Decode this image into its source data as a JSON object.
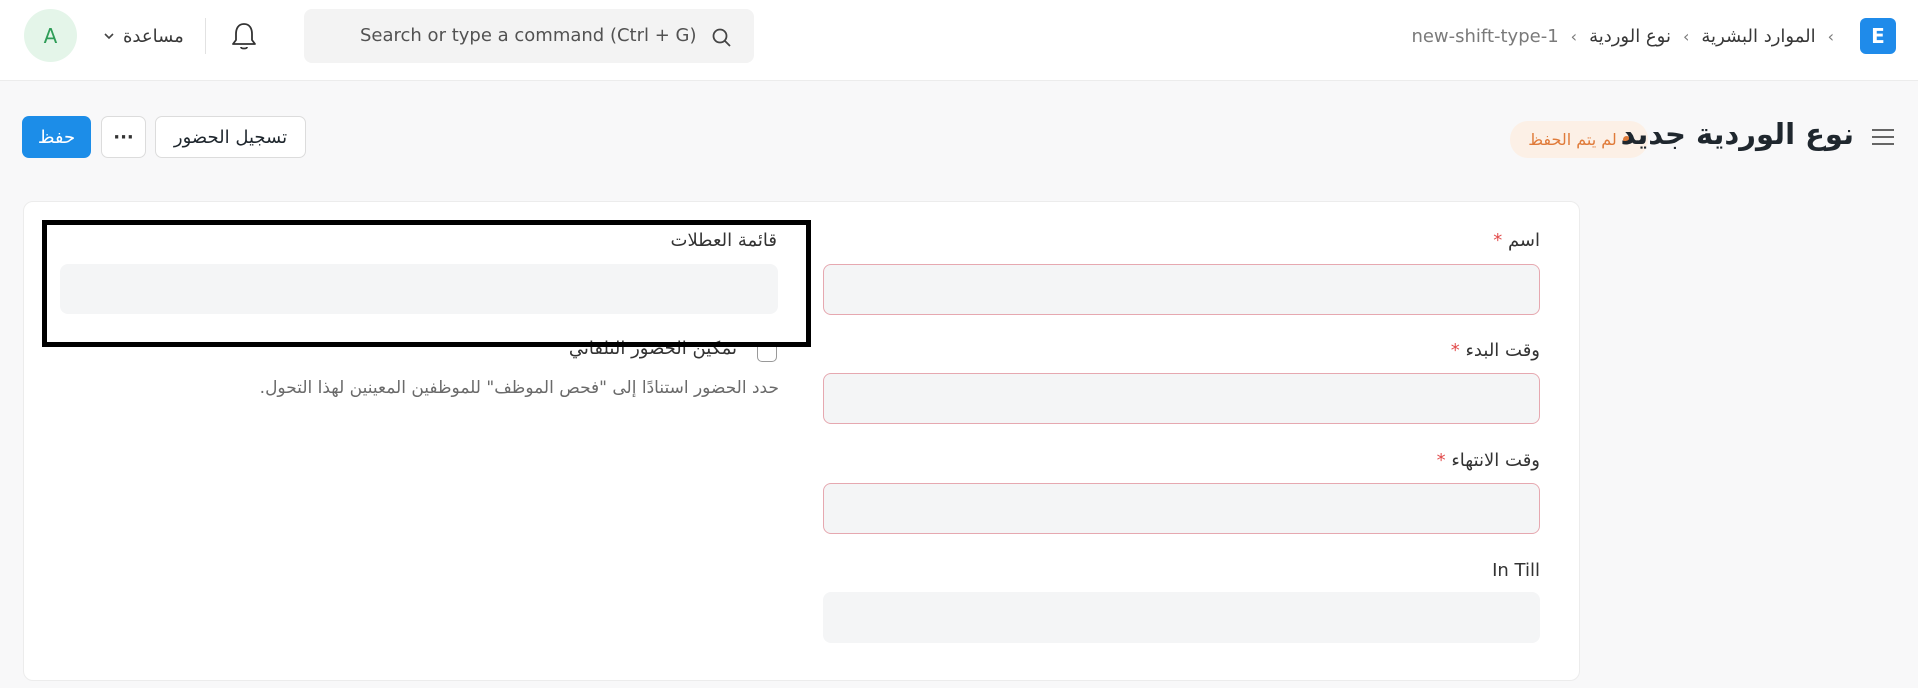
{
  "navbar": {
    "avatar_initial": "A",
    "help_label": "مساعدة",
    "search_placeholder": "Search or type a command (Ctrl + G)",
    "breadcrumb": [
      "الموارد البشرية",
      "نوع الوردية",
      "new-shift-type-1"
    ],
    "breadcrumb_separator": "›",
    "app_logo_letter": "E"
  },
  "toolbar": {
    "save_label": "حفظ",
    "more_label": "···",
    "attendance_label": "تسجيل الحضور"
  },
  "page": {
    "title": "نوع الوردية جديد",
    "status": "لم يتم الحفظ"
  },
  "form": {
    "name_label": "اسم",
    "start_time_label": "وقت البدء",
    "end_time_label": "وقت الانتهاء",
    "in_till_label": "In Till",
    "holiday_list_label": "قائمة العطلات",
    "auto_attendance_label": "تمكين الحضور التلقائي",
    "auto_attendance_desc": "حدد الحضور استنادًا إلى \"فحص الموظف\" للموظفين المعينين لهذا التحول.",
    "required_mark": "*"
  },
  "colors": {
    "primary": "#1c8de8",
    "status_orange": "#e07b3a",
    "required_border": "#e6a8b0"
  }
}
